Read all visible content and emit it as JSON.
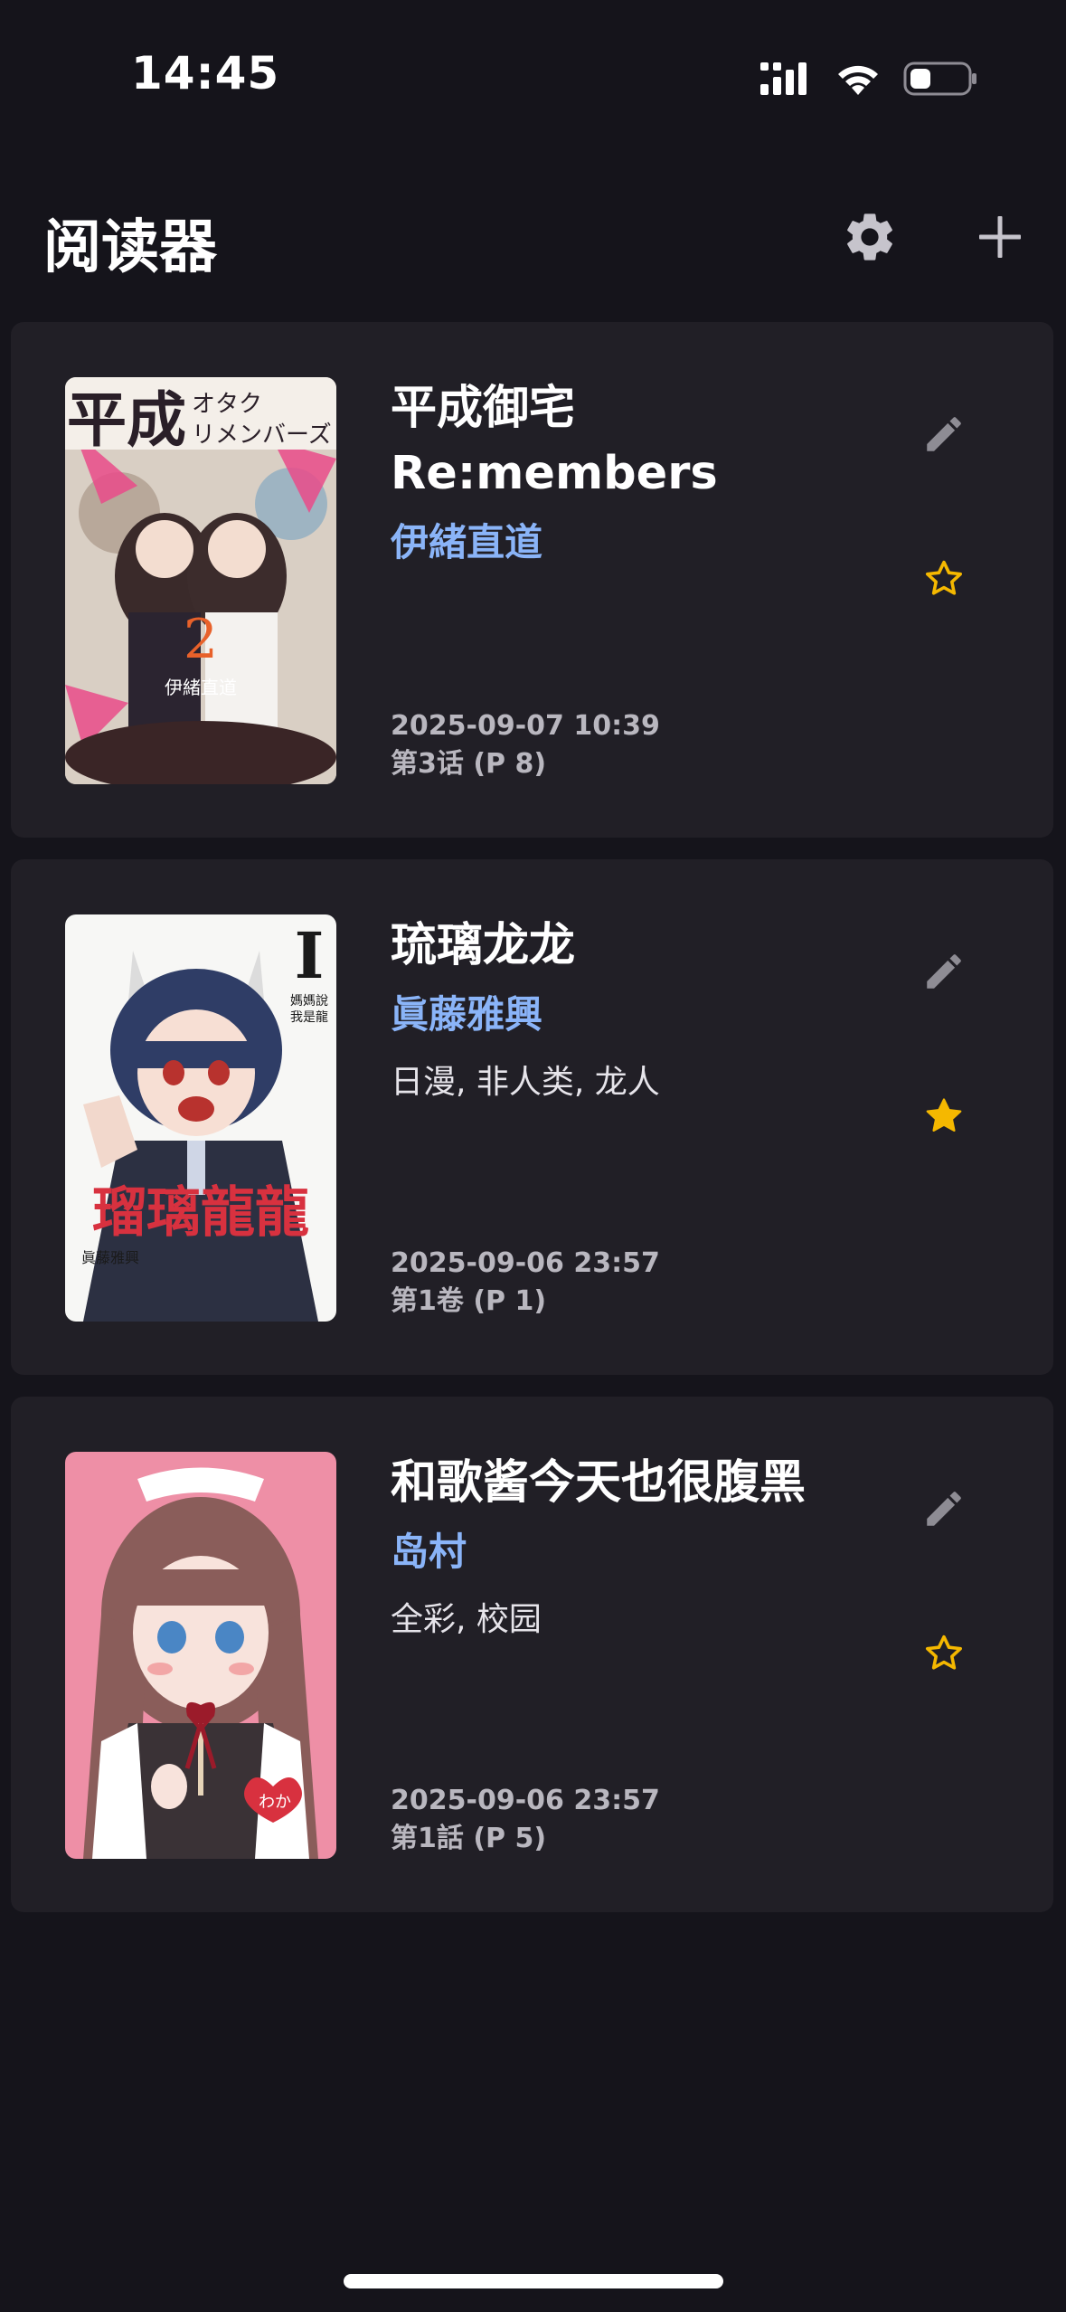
{
  "status_bar": {
    "time": "14:45",
    "icons": [
      "cellular-signal-icon",
      "wifi-icon",
      "battery-icon"
    ]
  },
  "header": {
    "title": "阅读器",
    "settings_icon": "gear-icon",
    "add_icon": "plus-icon"
  },
  "colors": {
    "background": "#15141b",
    "card": "#211f26",
    "author": "#8ab4f8",
    "star": "#f5b800",
    "icon_gray": "#8e8c94"
  },
  "books": [
    {
      "title": "平成御宅 Re:members",
      "author": "伊緒直道",
      "tags": "",
      "updated": "2025-09-07 10:39",
      "progress": "第3话 (P 8)",
      "favorite": false,
      "cover_text": "平成",
      "cover_sub": "オタク リメンバーズ"
    },
    {
      "title": "琉璃龙龙",
      "author": "眞藤雅興",
      "tags": "日漫, 非人类, 龙人",
      "updated": "2025-09-06 23:57",
      "progress": "第1卷 (P 1)",
      "favorite": true,
      "cover_text": "瑠璃龍龍",
      "cover_sub": "I"
    },
    {
      "title": "和歌酱今天也很腹黑",
      "author": "岛村",
      "tags": "全彩, 校园",
      "updated": "2025-09-06 23:57",
      "progress": "第1話 (P 5)",
      "favorite": false,
      "cover_text": "わか",
      "cover_sub": ""
    }
  ]
}
